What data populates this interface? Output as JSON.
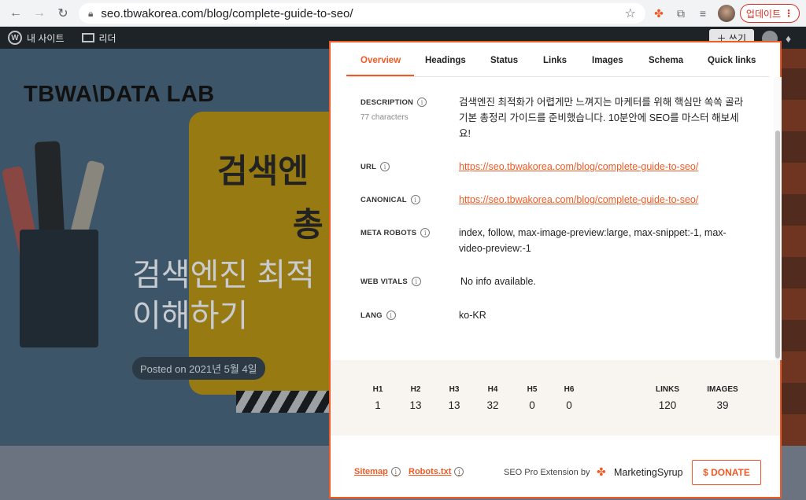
{
  "browser": {
    "url": "seo.tbwakorea.com/blog/complete-guide-to-seo/",
    "update_label": "업데이트",
    "update_menu": "⋮"
  },
  "wpbar": {
    "my_site": "내 사이트",
    "reader": "리더",
    "write": "쓰기"
  },
  "page": {
    "brand": "TBWA\\DATA LAB",
    "title_line1": "검색엔진 최적",
    "title_line2": "이해하기",
    "yellow_line1": "검색엔",
    "yellow_line2": "총",
    "posted": "Posted on 2021년 5월 4일"
  },
  "panel": {
    "tabs": [
      "Overview",
      "Headings",
      "Status",
      "Links",
      "Images",
      "Schema",
      "Quick links"
    ],
    "active_tab": "Overview",
    "description": {
      "label": "DESCRIPTION",
      "sub": "77 characters",
      "value": "검색엔진 최적화가 어렵게만 느껴지는 마케터를 위해 핵심만 쏙쏙 골라 기본 총정리 가이드를 준비했습니다. 10분안에 SEO를 마스터 해보세요!"
    },
    "url": {
      "label": "URL",
      "value": "https://seo.tbwakorea.com/blog/complete-guide-to-seo/"
    },
    "canonical": {
      "label": "CANONICAL",
      "value": "https://seo.tbwakorea.com/blog/complete-guide-to-seo/"
    },
    "meta_robots": {
      "label": "META ROBOTS",
      "value": "index, follow, max-image-preview:large, max-snippet:-1, max-video-preview:-1"
    },
    "web_vitals": {
      "label": "WEB VITALS",
      "value": "No info available."
    },
    "lang": {
      "label": "LANG",
      "value": "ko-KR"
    },
    "stats": [
      {
        "label": "H1",
        "value": "1"
      },
      {
        "label": "H2",
        "value": "13"
      },
      {
        "label": "H3",
        "value": "13"
      },
      {
        "label": "H4",
        "value": "32"
      },
      {
        "label": "H5",
        "value": "0"
      },
      {
        "label": "H6",
        "value": "0"
      },
      {
        "label": "LINKS",
        "value": "120"
      },
      {
        "label": "IMAGES",
        "value": "39"
      }
    ],
    "footer": {
      "sitemap": "Sitemap",
      "robots": "Robots.txt",
      "powered": "SEO Pro Extension by",
      "company": "MarketingSyrup",
      "donate": "$ DONATE"
    }
  },
  "colors": {
    "accent": "#f15a24"
  }
}
